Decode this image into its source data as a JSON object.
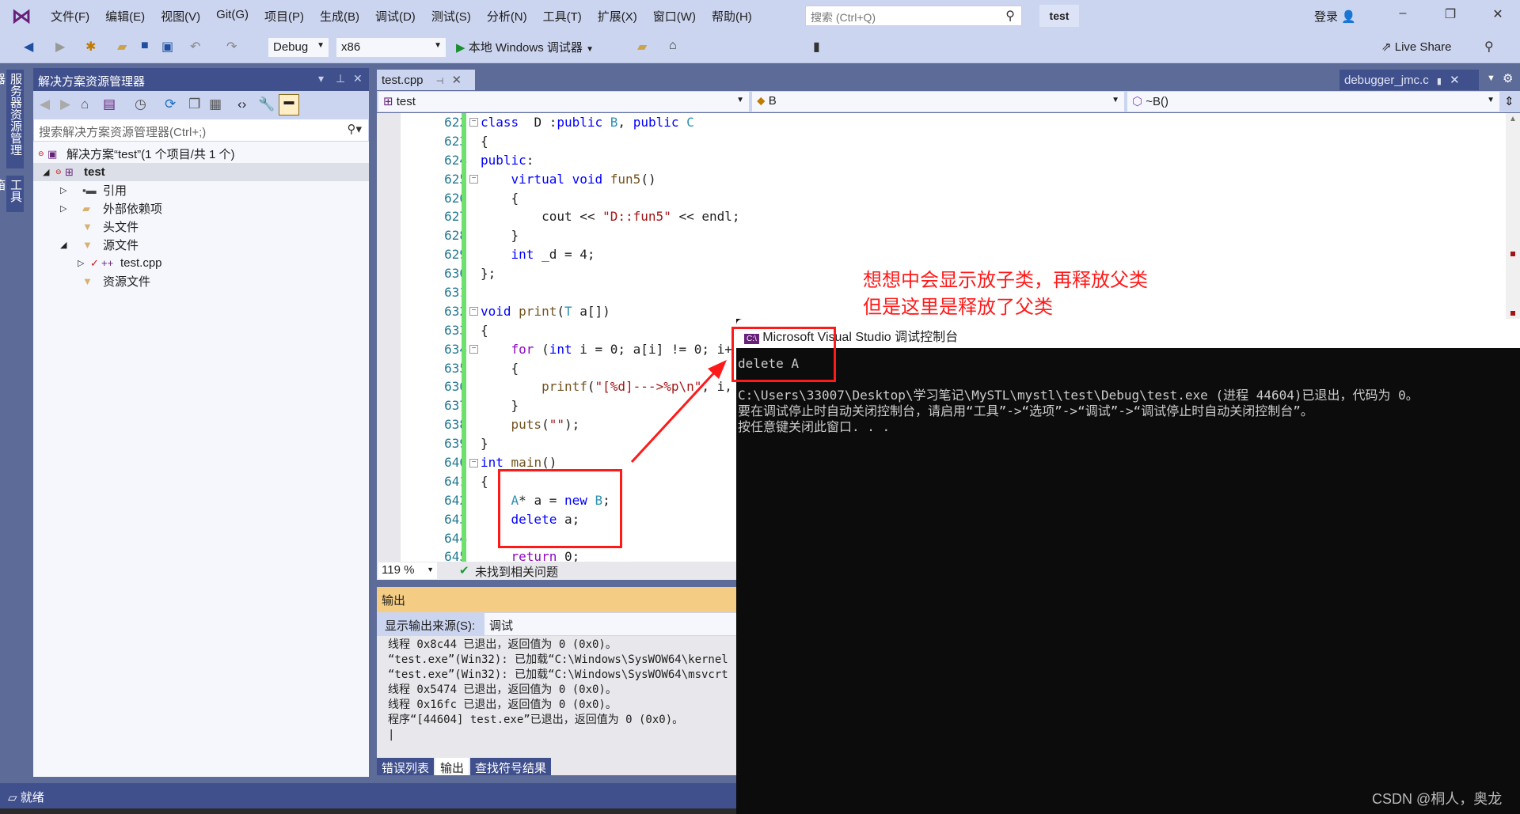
{
  "menubar": {
    "items": [
      "文件(F)",
      "编辑(E)",
      "视图(V)",
      "Git(G)",
      "项目(P)",
      "生成(B)",
      "调试(D)",
      "测试(S)",
      "分析(N)",
      "工具(T)",
      "扩展(X)",
      "窗口(W)",
      "帮助(H)"
    ],
    "search_placeholder": "搜索 (Ctrl+Q)",
    "solution_name": "test",
    "login": "登录"
  },
  "toolbar": {
    "config": "Debug",
    "platform": "x86",
    "run_label": "本地 Windows 调试器",
    "live_share": "Live Share"
  },
  "left_strip": [
    "服务器资源管理器",
    "工具箱"
  ],
  "solution_explorer": {
    "title": "解决方案资源管理器",
    "search_placeholder": "搜索解决方案资源管理器(Ctrl+;)",
    "tree": [
      {
        "label": "解决方案“test”(1 个项目/共 1 个)"
      },
      {
        "label": "test"
      },
      {
        "label": "引用"
      },
      {
        "label": "外部依赖项"
      },
      {
        "label": "头文件"
      },
      {
        "label": "源文件"
      },
      {
        "label": "test.cpp"
      },
      {
        "label": "资源文件"
      }
    ]
  },
  "editor": {
    "tab": "test.cpp",
    "preview_tab": "debugger_jmc.c",
    "nav": {
      "project": "test",
      "scope": "B",
      "member": "~B()"
    },
    "line_numbers": [
      "622",
      "623",
      "624",
      "625",
      "626",
      "627",
      "628",
      "629",
      "630",
      "631",
      "632",
      "633",
      "634",
      "635",
      "636",
      "637",
      "638",
      "639",
      "640",
      "641",
      "642",
      "643",
      "644",
      "645"
    ],
    "lines": [
      [
        [
          "k",
          "class"
        ],
        [
          "",
          "  D :"
        ],
        [
          "k",
          "public"
        ],
        [
          "",
          " "
        ],
        [
          "t",
          "B"
        ],
        [
          "",
          ", "
        ],
        [
          "k",
          "public"
        ],
        [
          "",
          " "
        ],
        [
          "t",
          "C"
        ]
      ],
      [
        [
          "",
          "{"
        ]
      ],
      [
        [
          "k",
          "public"
        ],
        [
          "",
          ":"
        ]
      ],
      [
        [
          "",
          "    "
        ],
        [
          "k",
          "virtual"
        ],
        [
          "",
          " "
        ],
        [
          "k",
          "void"
        ],
        [
          "",
          " "
        ],
        [
          "f",
          "fun5"
        ],
        [
          "",
          "()"
        ]
      ],
      [
        [
          "",
          "    {"
        ]
      ],
      [
        [
          "",
          "        cout << "
        ],
        [
          "s",
          "\"D::fun5\""
        ],
        [
          "",
          " << endl;"
        ]
      ],
      [
        [
          "",
          "    }"
        ]
      ],
      [
        [
          "",
          "    "
        ],
        [
          "k",
          "int"
        ],
        [
          "",
          " _d = 4;"
        ]
      ],
      [
        [
          "",
          "};"
        ]
      ],
      [],
      [
        [
          "k",
          "void"
        ],
        [
          "",
          " "
        ],
        [
          "f",
          "print"
        ],
        [
          "",
          "("
        ],
        [
          "t",
          "T"
        ],
        [
          "",
          " a[])"
        ]
      ],
      [
        [
          "",
          "{"
        ]
      ],
      [
        [
          "",
          "    "
        ],
        [
          "c",
          "for"
        ],
        [
          "",
          " ("
        ],
        [
          "k",
          "int"
        ],
        [
          "",
          " i = 0; a[i] != 0; i+"
        ]
      ],
      [
        [
          "",
          "    {"
        ]
      ],
      [
        [
          "",
          "        "
        ],
        [
          "f",
          "printf"
        ],
        [
          "",
          "("
        ],
        [
          "s",
          "\"[%d]--->%p\\n\""
        ],
        [
          "",
          ", i,"
        ]
      ],
      [
        [
          "",
          "    }"
        ]
      ],
      [
        [
          "",
          "    "
        ],
        [
          "f",
          "puts"
        ],
        [
          "",
          "("
        ],
        [
          "s",
          "\"\""
        ],
        [
          "",
          ");"
        ]
      ],
      [
        [
          "",
          "}"
        ]
      ],
      [
        [
          "k",
          "int"
        ],
        [
          "",
          " "
        ],
        [
          "f",
          "main"
        ],
        [
          "",
          "()"
        ]
      ],
      [
        [
          "",
          "{"
        ]
      ],
      [
        [
          "",
          "    "
        ],
        [
          "t",
          "A"
        ],
        [
          "",
          "* a = "
        ],
        [
          "k",
          "new"
        ],
        [
          "",
          " "
        ],
        [
          "t",
          "B"
        ],
        [
          "",
          ";"
        ]
      ],
      [
        [
          "",
          "    "
        ],
        [
          "k",
          "delete"
        ],
        [
          "",
          " a;"
        ]
      ],
      [],
      [
        [
          "",
          "    "
        ],
        [
          "c",
          "return"
        ],
        [
          "",
          " 0;"
        ]
      ]
    ],
    "zoom": "119 %",
    "issues": "未找到相关问题"
  },
  "output": {
    "title": "输出",
    "source_label": "显示输出来源(S):",
    "source_value": "调试",
    "lines": [
      "线程 0x8c44 已退出，返回值为 0 (0x0)。",
      "“test.exe”(Win32): 已加载“C:\\Windows\\SysWOW64\\kernel",
      "“test.exe”(Win32): 已加载“C:\\Windows\\SysWOW64\\msvcrt",
      "线程 0x5474 已退出，返回值为 0 (0x0)。",
      "线程 0x16fc 已退出，返回值为 0 (0x0)。",
      "程序“[44604] test.exe”已退出，返回值为 0 (0x0)。"
    ],
    "tabs": [
      "错误列表",
      "输出",
      "查找符号结果"
    ]
  },
  "status": "就绪",
  "console": {
    "title": "Microsoft Visual Studio 调试控制台",
    "lines": [
      "delete A",
      "",
      "C:\\Users\\33007\\Desktop\\学习笔记\\MySTL\\mystl\\test\\Debug\\test.exe (进程 44604)已退出，代码为 0。",
      "要在调试停止时自动关闭控制台，请启用“工具”->“选项”->“调试”->“调试停止时自动关闭控制台”。",
      "按任意键关闭此窗口. . ."
    ]
  },
  "annotation": {
    "line1": "想想中会显示放子类，再释放父类",
    "line2": "但是这里是释放了父类",
    "color": "#ff1a1a"
  },
  "watermark": "CSDN @桐人，奥龙"
}
